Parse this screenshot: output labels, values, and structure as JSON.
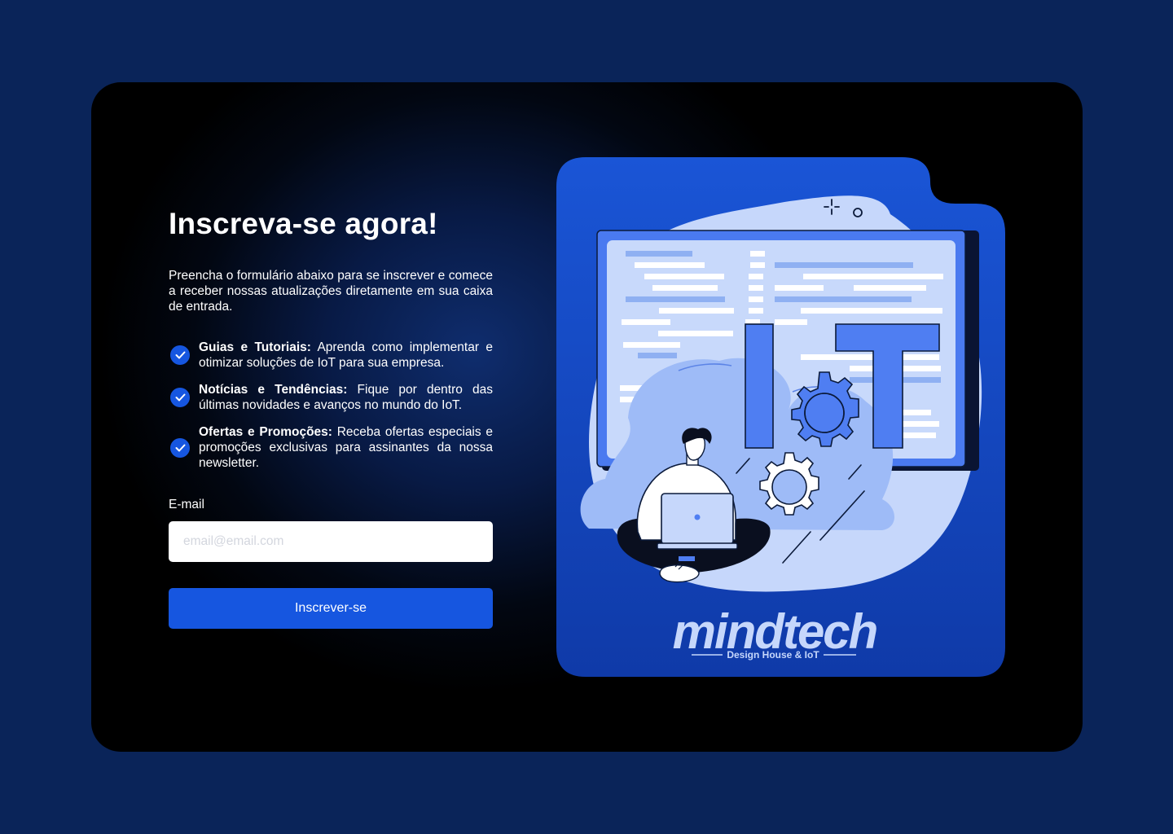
{
  "title": "Inscreva-se agora!",
  "intro": "Preencha o formulário abaixo para se inscrever e comece a receber nossas atualizações diretamente em sua caixa de entrada.",
  "benefits": [
    {
      "title": "Guias e Tutoriais:",
      "text": " Aprenda como implementar e otimizar soluções de IoT para sua empresa."
    },
    {
      "title": "Notícias e Tendências:",
      "text": " Fique por dentro das últimas novidades e avanços no mundo do IoT."
    },
    {
      "title": "Ofertas e Promoções:",
      "text": " Receba ofertas especiais e promoções exclusivas para assinantes da nossa newsletter."
    }
  ],
  "form": {
    "email_label": "E-mail",
    "email_placeholder": "email@email.com",
    "email_value": "",
    "submit_label": "Inscrever-se"
  },
  "illustration": {
    "iot_text": "IoT",
    "brand_name": "mindtech",
    "brand_tagline": "Design House & IoT"
  },
  "colors": {
    "page_bg": "#0a2459",
    "accent": "#1656e0",
    "illustration_bg": "#1a4fc9"
  },
  "icons": [
    "check-circle-icon",
    "gear-icon",
    "laptop-icon",
    "cloud-icon",
    "sparkle-icon"
  ]
}
